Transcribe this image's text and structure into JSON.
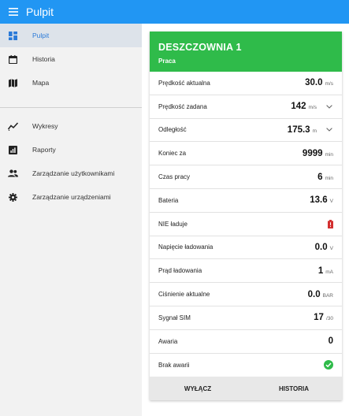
{
  "appbar": {
    "title": "Pulpit"
  },
  "sidebar": {
    "items": [
      {
        "label": "Pulpit",
        "icon": "dashboard-icon"
      },
      {
        "label": "Historia",
        "icon": "calendar-icon"
      },
      {
        "label": "Mapa",
        "icon": "map-icon"
      },
      {
        "label": "Wykresy",
        "icon": "line-chart-icon"
      },
      {
        "label": "Raporty",
        "icon": "report-icon"
      },
      {
        "label": "Zarządzanie użytkownikami",
        "icon": "users-icon"
      },
      {
        "label": "Zarządzanie urządzeniami",
        "icon": "gear-icon"
      }
    ]
  },
  "card": {
    "title": "DESZCZOWNIA 1",
    "subtitle": "Praca",
    "header_color": "#2fbb4a",
    "rows": [
      {
        "label": "Prędkość aktualna",
        "value": "30.0",
        "unit": "m/s"
      },
      {
        "label": "Prędkość zadana",
        "value": "142",
        "unit": "m/s"
      },
      {
        "label": "Odległość",
        "value": "175.3",
        "unit": "m"
      },
      {
        "label": "Koniec za",
        "value": "9999",
        "unit": "min"
      },
      {
        "label": "Czas pracy",
        "value": "6",
        "unit": "min"
      },
      {
        "label": "Bateria",
        "value": "13.6",
        "unit": "V"
      },
      {
        "label": "NIE ładuje",
        "icon": "battery-alert-icon"
      },
      {
        "label": "Napięcie ładowania",
        "value": "0.0",
        "unit": "V"
      },
      {
        "label": "Prąd ładowania",
        "value": "1",
        "unit": "mA"
      },
      {
        "label": "Ciśnienie aktualne",
        "value": "0.0",
        "unit": "BAR"
      },
      {
        "label": "Sygnał SIM",
        "value": "17",
        "unit": "/30"
      },
      {
        "label": "Awaria",
        "value": "0"
      },
      {
        "label": "Brak awarii",
        "icon": "check-circle-icon"
      }
    ],
    "actions": {
      "off": "WYŁĄCZ",
      "history": "HISTORIA"
    }
  }
}
